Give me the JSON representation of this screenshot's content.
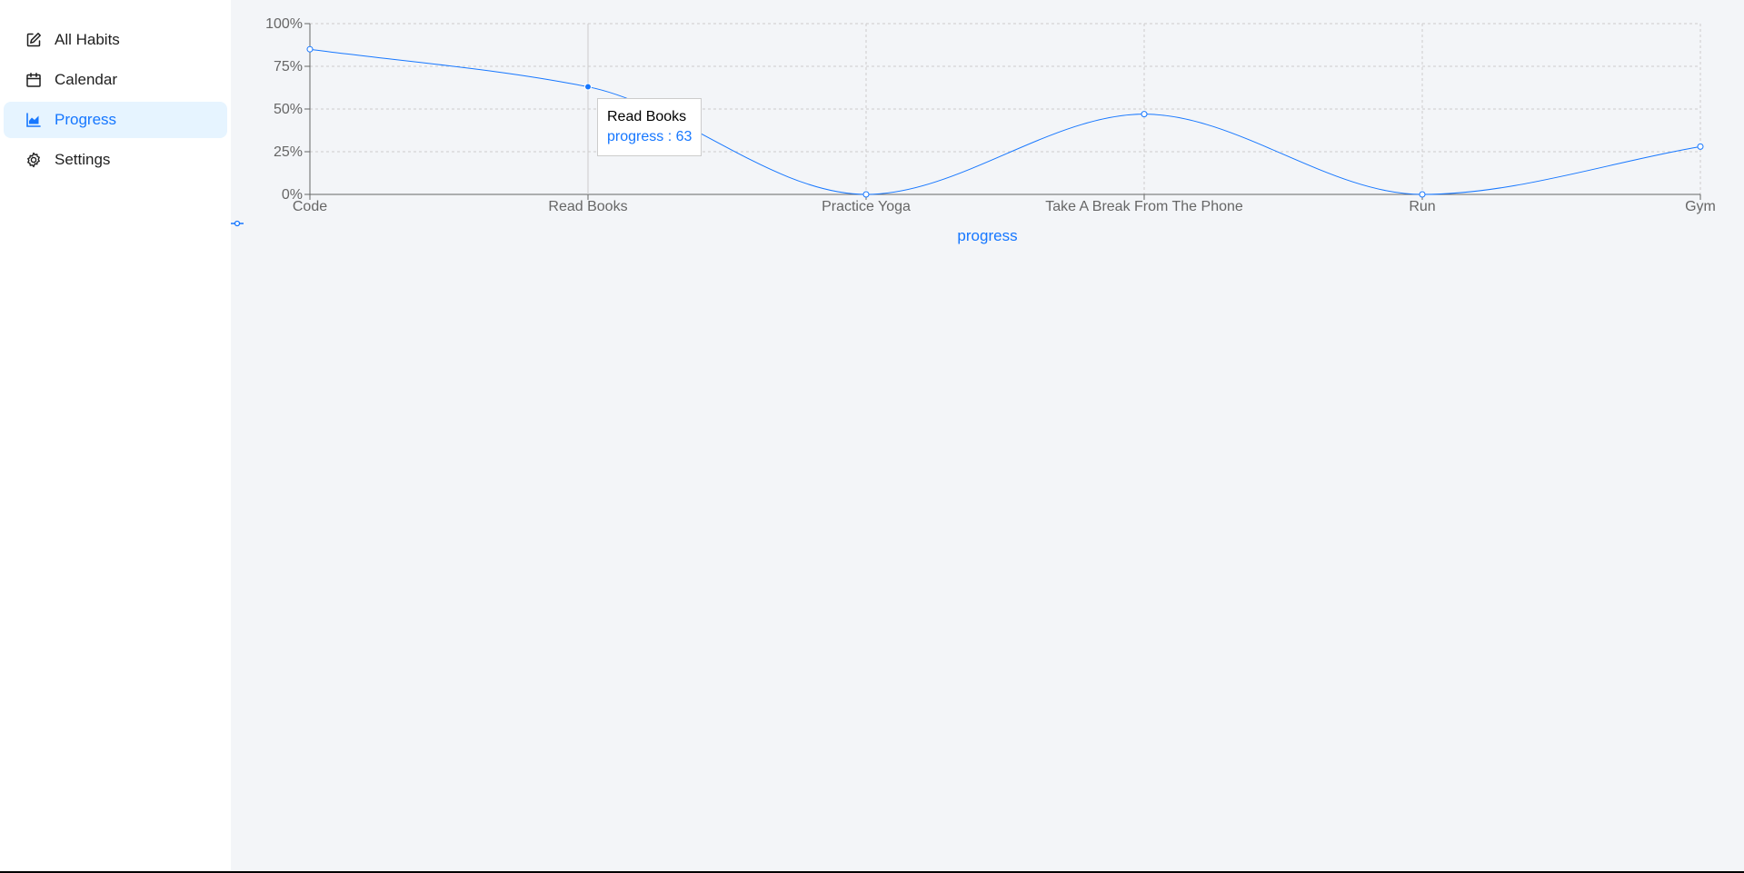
{
  "sidebar": {
    "items": [
      {
        "label": "All Habits",
        "icon": "edit-icon"
      },
      {
        "label": "Calendar",
        "icon": "calendar-icon"
      },
      {
        "label": "Progress",
        "icon": "area-chart-icon",
        "active": true
      },
      {
        "label": "Settings",
        "icon": "gear-icon"
      }
    ]
  },
  "colors": {
    "accent": "#1677ff",
    "active_bg": "#e6f4ff",
    "main_bg": "#f3f5f8"
  },
  "chart_data": {
    "type": "line",
    "categories": [
      "Code",
      "Read Books",
      "Practice Yoga",
      "Take A Break From The Phone",
      "Run",
      "Gym"
    ],
    "series": [
      {
        "name": "progress",
        "values": [
          85,
          63,
          0,
          47,
          0,
          28
        ]
      }
    ],
    "ylim": [
      0,
      100
    ],
    "yticks": [
      "0%",
      "25%",
      "50%",
      "75%",
      "100%"
    ],
    "ytick_values": [
      0,
      25,
      50,
      75,
      100
    ],
    "grid": true,
    "legend": "bottom",
    "color": "#1677ff",
    "active_index": 1
  },
  "tooltip": {
    "title": "Read Books",
    "value_text": "progress : 63"
  },
  "legend": {
    "label": "progress"
  }
}
